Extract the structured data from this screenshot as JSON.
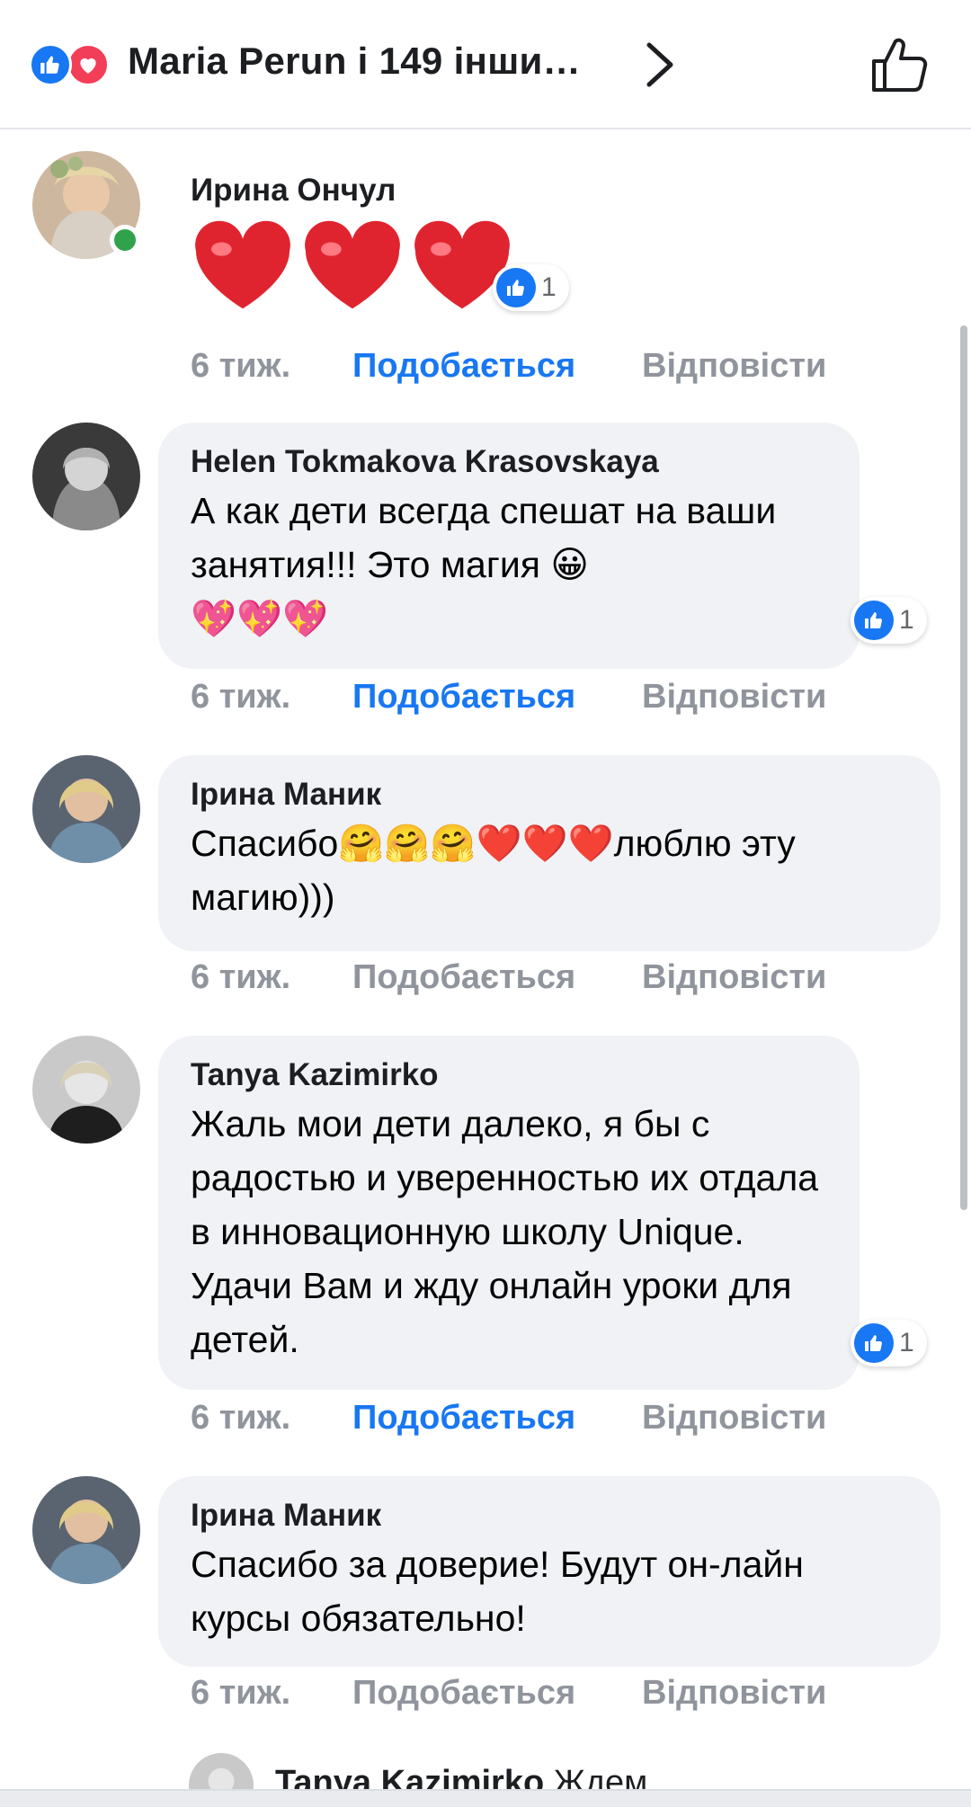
{
  "header": {
    "title": "Maria Perun і 149 інши…",
    "reactions": [
      "like-icon",
      "love-icon"
    ]
  },
  "colors": {
    "accent": "#1877f2",
    "love": "#f33e58",
    "bubble": "#f0f2f5",
    "meta_text": "#90949c",
    "online": "#31a24c"
  },
  "comments": [
    {
      "author": "Ирина Ончул",
      "text": "",
      "emoji": "❤️❤️❤️",
      "time": "6 тиж.",
      "like_label": "Подобається",
      "reply_label": "Відповісти",
      "liked": true,
      "reaction_count": "1",
      "online": true
    },
    {
      "author": "Helen Tokmakova Krasovskaya",
      "text": "А как дети всегда спешат на ваши занятия!!! Это магия 😀",
      "emoji": "💖💖💖",
      "time": "6 тиж.",
      "like_label": "Подобається",
      "reply_label": "Відповісти",
      "liked": true,
      "reaction_count": "1"
    },
    {
      "author": "Ірина Маник",
      "text": "Спасибо🤗🤗🤗❤️❤️❤️люблю эту магию)))",
      "time": "6 тиж.",
      "like_label": "Подобається",
      "reply_label": "Відповісти",
      "liked": false
    },
    {
      "author": "Tanya Kazimirko",
      "text": "Жаль мои дети далеко, я бы с радостью и уверенностью их отдала в инновационную школу Unique. Удачи Вам и жду онлайн уроки для детей.",
      "time": "6 тиж.",
      "like_label": "Подобається",
      "reply_label": "Відповісти",
      "liked": true,
      "reaction_count": "1"
    },
    {
      "author": "Ірина Маник",
      "text": "Спасибо за доверие! Будут он-лайн курсы обязательно!",
      "time": "6 тиж.",
      "like_label": "Подобається",
      "reply_label": "Відповісти",
      "liked": false
    }
  ],
  "peek_reply": {
    "author": "Tanya Kazimirko",
    "text": "Ждем"
  }
}
